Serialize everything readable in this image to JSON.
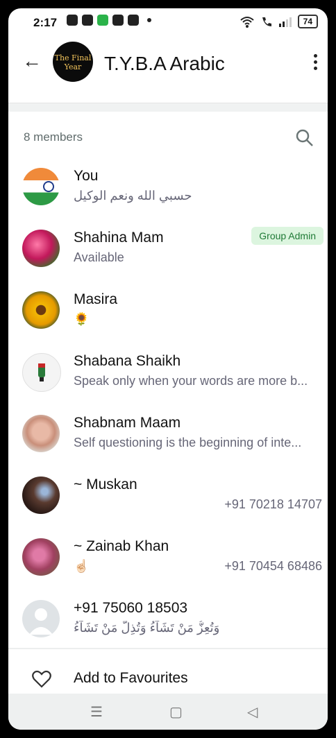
{
  "status": {
    "time": "2:17",
    "battery": "74"
  },
  "header": {
    "title": "T.Y.B.A Arabic",
    "avatar_text": "The Final Year"
  },
  "members_header": "8 members",
  "members": [
    {
      "name": "You",
      "sub": "حسبي الله ونعم الوكيل",
      "phone": "",
      "badge": ""
    },
    {
      "name": "Shahina Mam",
      "sub": "Available",
      "phone": "",
      "badge": "Group Admin"
    },
    {
      "name": "Masira",
      "sub": "🌻",
      "phone": "",
      "badge": ""
    },
    {
      "name": "Shabana Shaikh",
      "sub": "Speak only when your words are more b...",
      "phone": "",
      "badge": ""
    },
    {
      "name": "Shabnam Maam",
      "sub": "Self questioning is the beginning of inte...",
      "phone": "",
      "badge": ""
    },
    {
      "name": "~ Muskan",
      "sub": "",
      "phone": "+91 70218 14707",
      "badge": ""
    },
    {
      "name": "~ Zainab Khan",
      "sub": "☝🏻",
      "phone": "+91 70454 68486",
      "badge": ""
    },
    {
      "name": "+91 75060 18503",
      "sub": "وَتُعِزُّ مَنْ تَشَآءُ وَتُذِلُّ مَنْ تَشَآءُ",
      "phone": "",
      "badge": ""
    }
  ],
  "favourites_label": "Add to Favourites",
  "nav": {
    "recent": "☰",
    "home": "▢",
    "back": "◁"
  }
}
